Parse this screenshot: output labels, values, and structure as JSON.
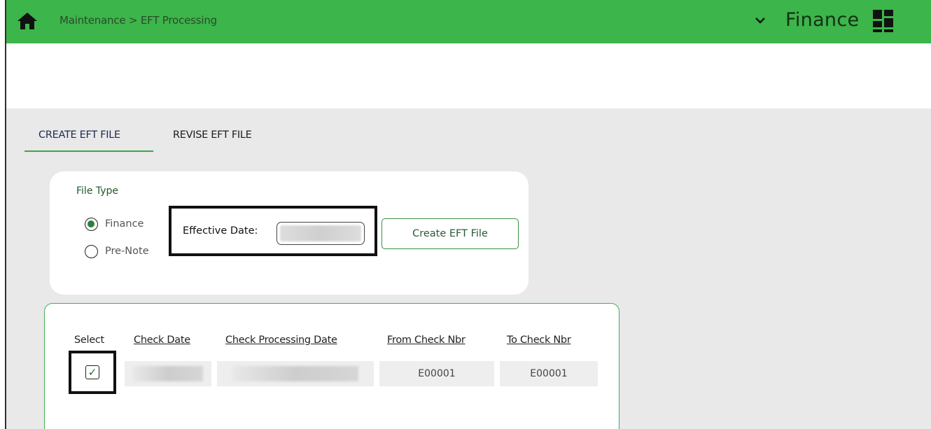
{
  "header": {
    "breadcrumb": "Maintenance > EFT Processing",
    "app_name": "Finance",
    "icons": [
      "home-icon",
      "chevron-down-icon",
      "grid-icon"
    ],
    "bg_color": "#3cb54a"
  },
  "tabs": [
    {
      "label": "CREATE EFT FILE",
      "active": true
    },
    {
      "label": "REVISE EFT FILE",
      "active": false
    }
  ],
  "file_type": {
    "label": "File Type",
    "options": [
      {
        "label": "Finance",
        "selected": true
      },
      {
        "label": "Pre-Note",
        "selected": false
      }
    ]
  },
  "effective_date": {
    "label": "Effective Date:"
  },
  "create_button": "Create EFT File",
  "table": {
    "headers": [
      "Select",
      "Check Date",
      "Check Processing Date",
      "From Check Nbr",
      "To Check Nbr"
    ],
    "row": {
      "checked": true,
      "from_check_nbr": "E00001",
      "to_check_nbr": "E00001"
    }
  },
  "colors": {
    "accent": "#3cb54a",
    "content_bg": "#e9e9ea"
  }
}
